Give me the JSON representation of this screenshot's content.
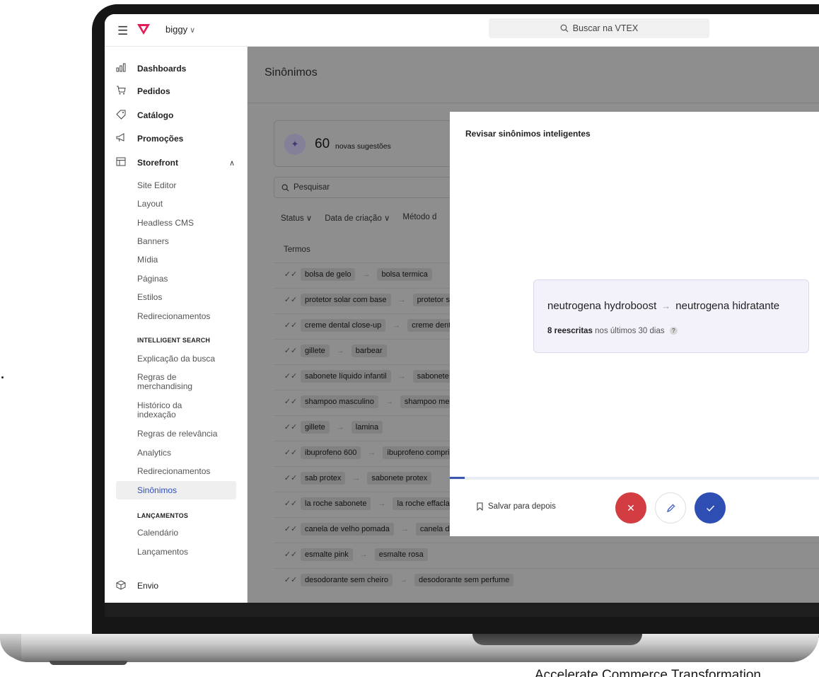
{
  "topbar": {
    "account_name": "biggy",
    "account_chevron": "∨",
    "search_placeholder": "Buscar na VTEX"
  },
  "sidebar": {
    "main_items": [
      {
        "label": "Dashboards",
        "icon": "bar-chart-icon"
      },
      {
        "label": "Pedidos",
        "icon": "cart-icon"
      },
      {
        "label": "Catálogo",
        "icon": "tag-icon"
      },
      {
        "label": "Promoções",
        "icon": "megaphone-icon"
      },
      {
        "label": "Storefront",
        "icon": "layout-icon",
        "expanded": true
      }
    ],
    "storefront_items": [
      "Site Editor",
      "Layout",
      "Headless CMS",
      "Banners",
      "Mídia",
      "Páginas",
      "Estilos",
      "Redirecionamentos"
    ],
    "intelligent_search_title": "INTELLIGENT SEARCH",
    "intelligent_search_items": [
      "Explicação da busca",
      "Regras de merchandising",
      "Histórico da indexação",
      "Regras de relevância",
      "Analytics",
      "Redirecionamentos",
      "Sinônimos"
    ],
    "active_item": "Sinônimos",
    "launches_title": "LANÇAMENTOS",
    "launches_items": [
      "Calendário",
      "Lançamentos"
    ],
    "bottom_item": {
      "label": "Envio",
      "icon": "box-icon"
    }
  },
  "main": {
    "title": "Sinônimos",
    "suggestions_count": "60",
    "suggestions_label": "novas sugestões",
    "search_placeholder": "Pesquisar",
    "filters": [
      "Status ∨",
      "Data de criação ∨",
      "Método d"
    ],
    "column_header": "Termos",
    "rows": [
      {
        "term": "bolsa de gelo",
        "synonym": "bolsa termica"
      },
      {
        "term": "protetor solar com base",
        "synonym": "protetor s"
      },
      {
        "term": "creme dental close-up",
        "synonym": "creme dent"
      },
      {
        "term": "gillete",
        "synonym": "barbear"
      },
      {
        "term": "sabonete líquido infantil",
        "synonym": "sabonete"
      },
      {
        "term": "shampoo masculino",
        "synonym": "shampoo mer"
      },
      {
        "term": "gillete",
        "synonym": "lamina"
      },
      {
        "term": "ibuprofeno 600",
        "synonym": "ibuprofeno compri"
      },
      {
        "term": "sab protex",
        "synonym": "sabonete protex"
      },
      {
        "term": "la roche sabonete",
        "synonym": "la roche effacla"
      },
      {
        "term": "canela de velho pomada",
        "synonym": "canela de"
      },
      {
        "term": "esmalte pink",
        "synonym": "esmalte rosa"
      },
      {
        "term": "desodorante sem cheiro",
        "synonym": "desodorante sem perfume"
      }
    ]
  },
  "modal": {
    "title": "Revisar sinônimos inteligentes",
    "term": "neutrogena hydroboost",
    "synonym": "neutrogena hidratante",
    "rewrites": "8 reescritas",
    "period": "nos últimos 30 dias",
    "help": "?",
    "progress": 0.04,
    "save_later": "Salvar para depois",
    "reject_icon": "close-icon",
    "edit_icon": "pencil-icon",
    "accept_icon": "check-icon"
  },
  "caption": "Accelerate Commerce Transformation",
  "colors": {
    "brand": "#e31c58",
    "accent": "#2f4eb4",
    "reject": "#d33c40",
    "overlay": "#8e8e8e",
    "suggestion_card": "#f3f2fb"
  }
}
